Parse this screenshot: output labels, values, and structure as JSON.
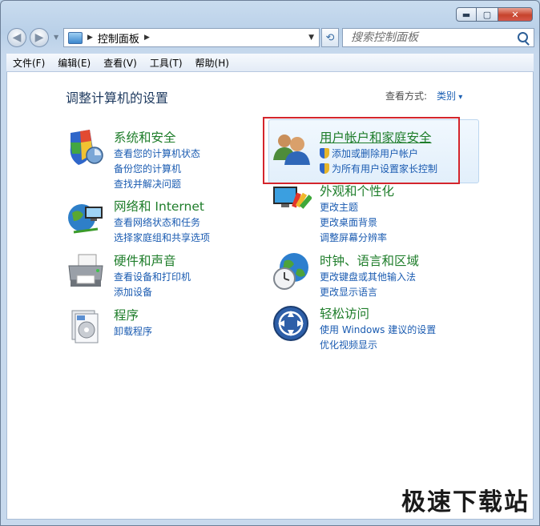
{
  "window": {
    "min_glyph": "▬",
    "max_glyph": "▢",
    "close_glyph": "✕"
  },
  "nav": {
    "back_icon": "back-arrow-icon",
    "forward_icon": "forward-arrow-icon",
    "breadcrumb": "控制面板",
    "search_placeholder": "搜索控制面板"
  },
  "menu": [
    "文件(F)",
    "编辑(E)",
    "查看(V)",
    "工具(T)",
    "帮助(H)"
  ],
  "page": {
    "title": "调整计算机的设置",
    "view_by_label": "查看方式:",
    "view_by_value": "类别"
  },
  "categories": [
    {
      "title": "系统和安全",
      "icon": "security-shield-icon",
      "links": [
        "查看您的计算机状态",
        "备份您的计算机",
        "查找并解决问题"
      ]
    },
    {
      "title": "网络和 Internet",
      "icon": "network-globe-icon",
      "links": [
        "查看网络状态和任务",
        "选择家庭组和共享选项"
      ]
    },
    {
      "title": "硬件和声音",
      "icon": "printer-icon",
      "links": [
        "查看设备和打印机",
        "添加设备"
      ]
    },
    {
      "title": "程序",
      "icon": "programs-icon",
      "links": [
        "卸载程序"
      ]
    },
    {
      "title": "用户帐户和家庭安全",
      "icon": "users-icon",
      "links": [
        "添加或删除用户帐户",
        "为所有用户设置家长控制"
      ]
    },
    {
      "title": "外观和个性化",
      "icon": "monitor-palette-icon",
      "links": [
        "更改主题",
        "更改桌面背景",
        "调整屏幕分辨率"
      ]
    },
    {
      "title": "时钟、语言和区域",
      "icon": "clock-globe-icon",
      "links": [
        "更改键盘或其他输入法",
        "更改显示语言"
      ]
    },
    {
      "title": "轻松访问",
      "icon": "ease-of-access-icon",
      "links": [
        "使用 Windows 建议的设置",
        "优化视频显示"
      ]
    }
  ],
  "watermark": "极速下载站"
}
